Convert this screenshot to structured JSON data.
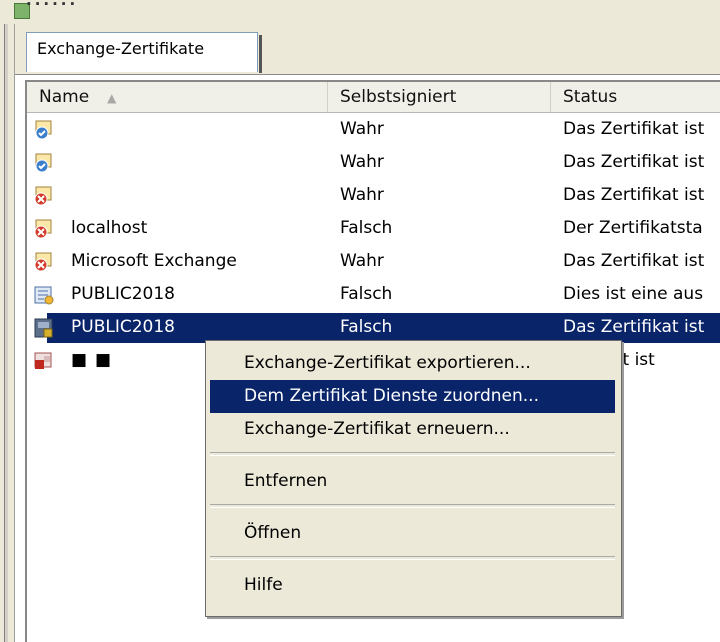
{
  "window": {
    "title_fragment": "......"
  },
  "tabs": [
    {
      "label": "Exchange-Zertifikate"
    }
  ],
  "columns": {
    "name": "Name",
    "selbstsigniert": "Selbstsigniert",
    "status": "Status"
  },
  "rows": [
    {
      "name": "",
      "self_signed": "Wahr",
      "status": "Das Zertifikat ist",
      "icon": "certificate-valid-icon"
    },
    {
      "name": "",
      "self_signed": "Wahr",
      "status": "Das Zertifikat ist",
      "icon": "certificate-valid-icon"
    },
    {
      "name": "",
      "self_signed": "Wahr",
      "status": "Das Zertifikat ist",
      "icon": "certificate-error-icon"
    },
    {
      "name": "localhost",
      "self_signed": "Falsch",
      "status": "Der Zertifikatsta",
      "icon": "certificate-error-icon"
    },
    {
      "name": "Microsoft Exchange",
      "self_signed": "Wahr",
      "status": "Das Zertifikat ist",
      "icon": "certificate-error-icon"
    },
    {
      "name": "PUBLIC2018",
      "self_signed": "Falsch",
      "status": "Dies ist eine aus",
      "icon": "certificate-request-icon"
    },
    {
      "name": "PUBLIC2018",
      "self_signed": "Falsch",
      "status": "Das Zertifikat ist",
      "icon": "certificate-server-icon"
    },
    {
      "name": "",
      "self_signed": "",
      "status": "ertifikat ist",
      "icon": "certificate-error-icon"
    }
  ],
  "context_menu": {
    "export": "Exchange-Zertifikat exportieren...",
    "assign": "Dem Zertifikat Dienste zuordnen...",
    "renew": "Exchange-Zertifikat erneuern...",
    "remove": "Entfernen",
    "open": "Öffnen",
    "help": "Hilfe"
  }
}
